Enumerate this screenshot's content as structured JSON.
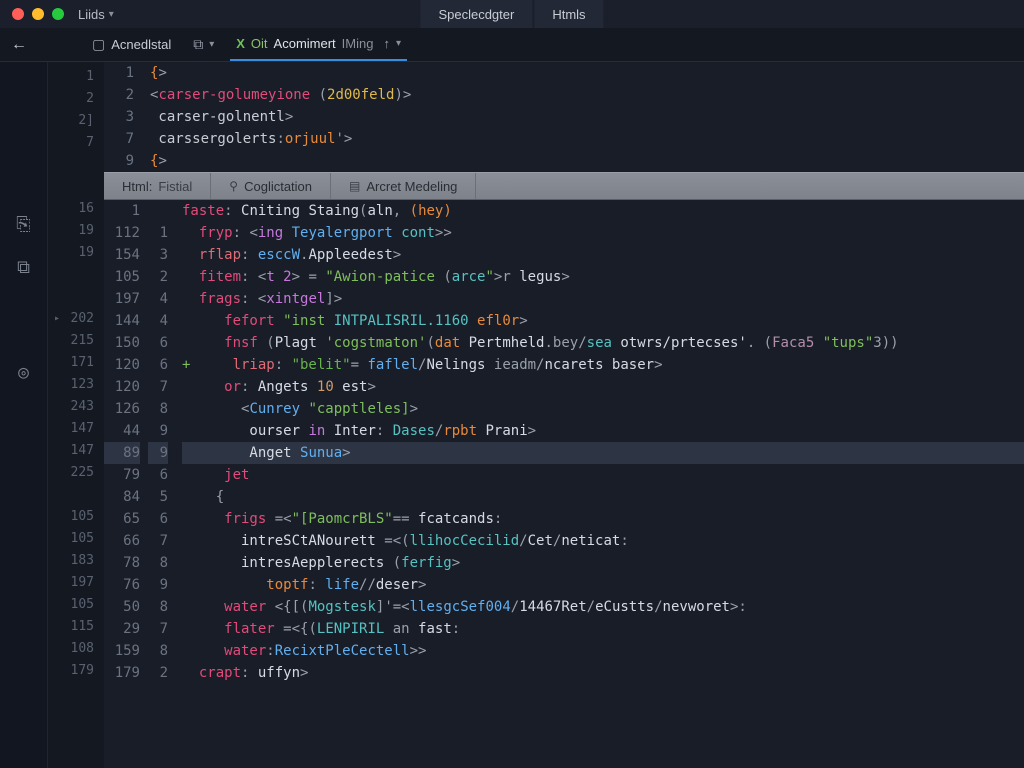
{
  "titlebar": {
    "left_label": "Liids",
    "tabs": [
      "Speclecdgter",
      "Htmls"
    ]
  },
  "toolbar": {
    "back_glyph": "←",
    "item1_label": "Acnedlstal",
    "item2_icon": "⧉",
    "item3_x": "X",
    "item3_prefix": "Oit",
    "item3_label": "Acomimert",
    "item3_suffix": "IMing",
    "up_glyph": "↑"
  },
  "top_pane": {
    "gutter": [
      "1",
      "2",
      "3",
      "7",
      "9"
    ],
    "rows": [
      {
        "segments": [
          {
            "t": "{",
            "c": "c-attr"
          },
          {
            "t": ">",
            "c": "c-punc"
          }
        ]
      },
      {
        "segments": [
          {
            "t": "<",
            "c": "c-punc"
          },
          {
            "t": "carser-golumeyione",
            "c": "c-tag"
          },
          {
            "t": " (",
            "c": "c-punc"
          },
          {
            "t": "2d00feld",
            "c": "c-attr2"
          },
          {
            "t": ")",
            "c": "c-punc"
          },
          {
            "t": ">",
            "c": "c-punc"
          }
        ]
      },
      {
        "segments": [
          {
            "t": " carser-golnentl",
            "c": "c-plain"
          },
          {
            "t": ">",
            "c": "c-punc"
          }
        ]
      },
      {
        "segments": [
          {
            "t": " carssergolerts",
            "c": "c-plain"
          },
          {
            "t": ":",
            "c": "c-punc"
          },
          {
            "t": "orjuul",
            "c": "c-attr"
          },
          {
            "t": "'>",
            "c": "c-punc"
          }
        ]
      },
      {
        "segments": [
          {
            "t": "{",
            "c": "c-attr"
          },
          {
            "t": ">",
            "c": "c-punc"
          }
        ]
      }
    ]
  },
  "inner_tabs": [
    {
      "label": "Html:",
      "suffix": "Fistial"
    },
    {
      "icon": "⚲",
      "label": "Coglictation"
    },
    {
      "icon": "▤",
      "label": "Arcret Medeling"
    }
  ],
  "outer_gutter": [
    "1",
    "2",
    "2]",
    "7",
    " ",
    " ",
    "16",
    "19",
    "19",
    " ",
    " ",
    "202",
    "215",
    "171",
    "123",
    "243",
    "147",
    "147",
    "225",
    " ",
    "105",
    "105",
    "183",
    "197",
    "105",
    "115",
    "108",
    "179"
  ],
  "outer_gutter_carets": {
    "11": true
  },
  "bottom_pane": {
    "highlight_index": 12,
    "rows": [
      {
        "g2": "1",
        "g3": "",
        "diff": "",
        "segs": [
          {
            "t": "faste",
            "c": "c-pink"
          },
          {
            "t": ": ",
            "c": "c-punc"
          },
          {
            "t": "Cniting Staing",
            "c": "c-white"
          },
          {
            "t": "(",
            "c": "c-punc"
          },
          {
            "t": "aln",
            "c": "c-white"
          },
          {
            "t": ", ",
            "c": "c-punc"
          },
          {
            "t": "(",
            "c": "c-attr"
          },
          {
            "t": "hey",
            "c": "c-attr"
          },
          {
            "t": ")",
            "c": "c-attr"
          }
        ]
      },
      {
        "g2": "112",
        "g3": "1",
        "diff": "",
        "segs": [
          {
            "t": "  fryp",
            "c": "c-pink"
          },
          {
            "t": ": ",
            "c": "c-punc"
          },
          {
            "t": "<",
            "c": "c-punc"
          },
          {
            "t": "ing",
            "c": "c-kw"
          },
          {
            "t": " ",
            "c": "c-punc"
          },
          {
            "t": "Teyalergport",
            "c": "c-blue"
          },
          {
            "t": " ",
            "c": "c-punc"
          },
          {
            "t": "cont",
            "c": "c-cyan"
          },
          {
            "t": ">>",
            "c": "c-punc"
          }
        ]
      },
      {
        "g2": "154",
        "g3": "3",
        "diff": "",
        "segs": [
          {
            "t": "  rflap",
            "c": "c-var"
          },
          {
            "t": ": ",
            "c": "c-punc"
          },
          {
            "t": "esccW",
            "c": "c-blue"
          },
          {
            "t": ".",
            "c": "c-punc"
          },
          {
            "t": "Appleedest",
            "c": "c-white"
          },
          {
            "t": ">",
            "c": "c-punc"
          }
        ]
      },
      {
        "g2": "105",
        "g3": "2",
        "diff": "",
        "segs": [
          {
            "t": "  fitem",
            "c": "c-pink"
          },
          {
            "t": ": ",
            "c": "c-punc"
          },
          {
            "t": "<",
            "c": "c-punc"
          },
          {
            "t": "t 2",
            "c": "c-kw"
          },
          {
            "t": "> = ",
            "c": "c-punc"
          },
          {
            "t": "\"Awion-patice",
            "c": "c-str"
          },
          {
            "t": " (",
            "c": "c-punc"
          },
          {
            "t": "arce",
            "c": "c-cyan"
          },
          {
            "t": "\"",
            "c": "c-str"
          },
          {
            "t": ">r ",
            "c": "c-punc"
          },
          {
            "t": "legus",
            "c": "c-white"
          },
          {
            "t": ">",
            "c": "c-punc"
          }
        ]
      },
      {
        "g2": "197",
        "g3": "4",
        "diff": "",
        "segs": [
          {
            "t": "  frags",
            "c": "c-pink"
          },
          {
            "t": ": ",
            "c": "c-punc"
          },
          {
            "t": "<",
            "c": "c-punc"
          },
          {
            "t": "xintgel",
            "c": "c-kw"
          },
          {
            "t": "]>",
            "c": "c-punc"
          }
        ]
      },
      {
        "g2": "144",
        "g3": "4",
        "diff": "",
        "segs": [
          {
            "t": "     fefort ",
            "c": "c-pink"
          },
          {
            "t": "\"inst ",
            "c": "c-str"
          },
          {
            "t": "INTPALISRIL.1160",
            "c": "c-cyan"
          },
          {
            "t": " ",
            "c": "c-punc"
          },
          {
            "t": "efl0r",
            "c": "c-attr"
          },
          {
            "t": ">",
            "c": "c-punc"
          }
        ]
      },
      {
        "g2": "150",
        "g3": "6",
        "diff": "",
        "segs": [
          {
            "t": "     fnsf ",
            "c": "c-pink"
          },
          {
            "t": "(",
            "c": "c-punc"
          },
          {
            "t": "Plagt ",
            "c": "c-white"
          },
          {
            "t": "'cogstmaton'",
            "c": "c-str"
          },
          {
            "t": "(",
            "c": "c-punc"
          },
          {
            "t": "dat",
            "c": "c-attr"
          },
          {
            "t": " Pertmheld",
            "c": "c-white"
          },
          {
            "t": ".bey/",
            "c": "c-punc"
          },
          {
            "t": "sea",
            "c": "c-cyan"
          },
          {
            "t": " otwrs/prtecses'",
            "c": "c-white"
          },
          {
            "t": ". ",
            "c": "c-punc"
          },
          {
            "t": "(",
            "c": "c-punc"
          },
          {
            "t": "Faca5",
            "c": "c-lav"
          },
          {
            "t": " ",
            "c": "c-punc"
          },
          {
            "t": "\"tups\"",
            "c": "c-str"
          },
          {
            "t": "3))",
            "c": "c-punc"
          }
        ]
      },
      {
        "g2": "120",
        "g3": "6",
        "diff": "+",
        "segs": [
          {
            "t": "    lriap",
            "c": "c-var"
          },
          {
            "t": ": ",
            "c": "c-punc"
          },
          {
            "t": "\"belit\"",
            "c": "c-str2"
          },
          {
            "t": "= ",
            "c": "c-punc"
          },
          {
            "t": "faflel",
            "c": "c-blue"
          },
          {
            "t": "/",
            "c": "c-punc"
          },
          {
            "t": "Nelings",
            "c": "c-white"
          },
          {
            "t": " ieadm/",
            "c": "c-punc"
          },
          {
            "t": "ncarets baser",
            "c": "c-white"
          },
          {
            "t": ">",
            "c": "c-punc"
          }
        ]
      },
      {
        "g2": "120",
        "g3": "7",
        "diff": "",
        "segs": [
          {
            "t": "     or",
            "c": "c-pink"
          },
          {
            "t": ": ",
            "c": "c-punc"
          },
          {
            "t": "Angets ",
            "c": "c-white"
          },
          {
            "t": "10",
            "c": "c-num"
          },
          {
            "t": " est",
            "c": "c-white"
          },
          {
            "t": ">",
            "c": "c-punc"
          }
        ]
      },
      {
        "g2": "126",
        "g3": "8",
        "diff": "",
        "segs": [
          {
            "t": "       <",
            "c": "c-punc"
          },
          {
            "t": "Cunrey",
            "c": "c-blue"
          },
          {
            "t": " ",
            "c": "c-punc"
          },
          {
            "t": "\"capptleles]",
            "c": "c-str"
          },
          {
            "t": ">",
            "c": "c-punc"
          }
        ]
      },
      {
        "g2": "44",
        "g3": "9",
        "diff": "",
        "segs": [
          {
            "t": "        ourser ",
            "c": "c-white"
          },
          {
            "t": "in",
            "c": "c-kw"
          },
          {
            "t": " Inter",
            "c": "c-white"
          },
          {
            "t": ": ",
            "c": "c-punc"
          },
          {
            "t": "Dases",
            "c": "c-cyan"
          },
          {
            "t": "/",
            "c": "c-punc"
          },
          {
            "t": "rpbt",
            "c": "c-attr"
          },
          {
            "t": " Prani",
            "c": "c-white"
          },
          {
            "t": ">",
            "c": "c-punc"
          }
        ]
      },
      {
        "g2": "89",
        "g3": "9",
        "diff": "",
        "segs": [
          {
            "t": "        Anget ",
            "c": "c-white"
          },
          {
            "t": "Sunua",
            "c": "c-blue"
          },
          {
            "t": ">",
            "c": "c-punc"
          }
        ]
      },
      {
        "g2": "79",
        "g3": "6",
        "diff": "",
        "segs": [
          {
            "t": "     jet",
            "c": "c-pink"
          }
        ]
      },
      {
        "g2": "84",
        "g3": "5",
        "diff": "",
        "segs": [
          {
            "t": "    {",
            "c": "c-punc"
          }
        ]
      },
      {
        "g2": "65",
        "g3": "6",
        "diff": "",
        "segs": [
          {
            "t": "     frigs ",
            "c": "c-pink"
          },
          {
            "t": "=<",
            "c": "c-punc"
          },
          {
            "t": "\"[PaomcrBLS\"",
            "c": "c-str"
          },
          {
            "t": "== ",
            "c": "c-punc"
          },
          {
            "t": "fcatcands",
            "c": "c-white"
          },
          {
            "t": ":",
            "c": "c-punc"
          }
        ]
      },
      {
        "g2": "66",
        "g3": "7",
        "diff": "",
        "segs": [
          {
            "t": "       intreSCtANourett ",
            "c": "c-white"
          },
          {
            "t": "=<",
            "c": "c-punc"
          },
          {
            "t": "(",
            "c": "c-punc"
          },
          {
            "t": "llihocCecilid",
            "c": "c-cyan"
          },
          {
            "t": "/",
            "c": "c-punc"
          },
          {
            "t": "Cet",
            "c": "c-white"
          },
          {
            "t": "/",
            "c": "c-punc"
          },
          {
            "t": "neticat",
            "c": "c-white"
          },
          {
            "t": ":",
            "c": "c-punc"
          }
        ]
      },
      {
        "g2": "78",
        "g3": "8",
        "diff": "",
        "segs": [
          {
            "t": "       intresAepplerects ",
            "c": "c-white"
          },
          {
            "t": "(",
            "c": "c-punc"
          },
          {
            "t": "ferfig",
            "c": "c-cyan"
          },
          {
            "t": ">",
            "c": "c-punc"
          }
        ]
      },
      {
        "g2": "76",
        "g3": "9",
        "diff": "",
        "segs": [
          {
            "t": "          toptf",
            "c": "c-attr"
          },
          {
            "t": ": ",
            "c": "c-punc"
          },
          {
            "t": "life",
            "c": "c-blue"
          },
          {
            "t": "//",
            "c": "c-punc"
          },
          {
            "t": "deser",
            "c": "c-white"
          },
          {
            "t": ">",
            "c": "c-punc"
          }
        ]
      },
      {
        "g2": "50",
        "g3": "8",
        "diff": "",
        "segs": [
          {
            "t": "     water ",
            "c": "c-pink"
          },
          {
            "t": "<",
            "c": "c-punc"
          },
          {
            "t": "{[",
            "c": "c-punc"
          },
          {
            "t": "(",
            "c": "c-punc"
          },
          {
            "t": "Mogstesk",
            "c": "c-cyan"
          },
          {
            "t": "]",
            "c": "c-punc"
          },
          {
            "t": "'=<",
            "c": "c-punc"
          },
          {
            "t": "llesgcSef004",
            "c": "c-blue"
          },
          {
            "t": "/",
            "c": "c-punc"
          },
          {
            "t": "14467Ret",
            "c": "c-white"
          },
          {
            "t": "/",
            "c": "c-punc"
          },
          {
            "t": "eCustts",
            "c": "c-white"
          },
          {
            "t": "/",
            "c": "c-punc"
          },
          {
            "t": "nevworet",
            "c": "c-white"
          },
          {
            "t": ">:",
            "c": "c-punc"
          }
        ]
      },
      {
        "g2": "29",
        "g3": "7",
        "diff": "",
        "segs": [
          {
            "t": "     flater ",
            "c": "c-pink"
          },
          {
            "t": "=<",
            "c": "c-punc"
          },
          {
            "t": "{",
            "c": "c-punc"
          },
          {
            "t": "(",
            "c": "c-punc"
          },
          {
            "t": "LENPIRIL",
            "c": "c-cyan"
          },
          {
            "t": " an ",
            "c": "c-punc"
          },
          {
            "t": "fast",
            "c": "c-white"
          },
          {
            "t": ":",
            "c": "c-punc"
          }
        ]
      },
      {
        "g2": "159",
        "g3": "8",
        "diff": "",
        "segs": [
          {
            "t": "     water",
            "c": "c-pink"
          },
          {
            "t": ":",
            "c": "c-punc"
          },
          {
            "t": "RecixtPleCectell",
            "c": "c-blue"
          },
          {
            "t": ">>",
            "c": "c-punc"
          }
        ]
      },
      {
        "g2": "179",
        "g3": "2",
        "diff": "",
        "segs": [
          {
            "t": "  crapt",
            "c": "c-pink"
          },
          {
            "t": ": ",
            "c": "c-punc"
          },
          {
            "t": "uffyn",
            "c": "c-white"
          },
          {
            "t": ">",
            "c": "c-punc"
          }
        ]
      }
    ]
  },
  "activity_icons": [
    "⎘",
    "⧉",
    "◎"
  ]
}
